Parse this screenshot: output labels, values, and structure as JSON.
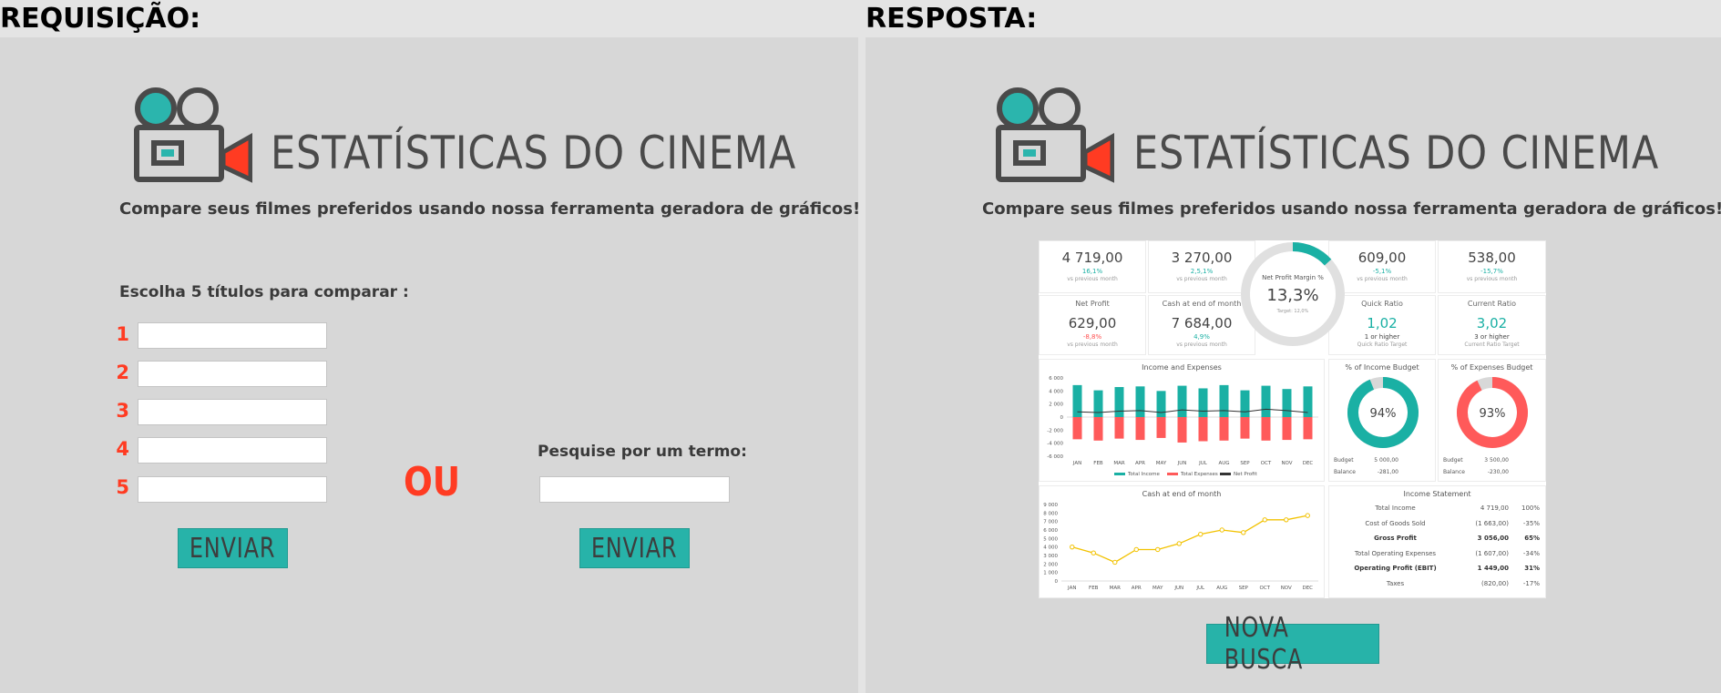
{
  "headers": {
    "left": "REQUISIÇÃO:",
    "right": "RESPOSTA:"
  },
  "logo": {
    "title": "ESTATÍSTICAS DO CINEMA",
    "subtitle": "Compare seus filmes preferidos usando nossa ferramenta geradora de gráficos!"
  },
  "colors": {
    "teal": "#27b3a9",
    "red": "#ff3b22",
    "dark": "#4a4a4a",
    "panel": "#d7d7d7"
  },
  "request": {
    "choose_label": "Escolha 5 títulos para comparar :",
    "numbers": [
      "1",
      "2",
      "3",
      "4",
      "5"
    ],
    "titles": [
      "",
      "",
      "",
      "",
      ""
    ],
    "or_label": "OU",
    "search_label": "Pesquise por um termo:",
    "search_value": "",
    "submit_titles": "ENVIAR",
    "submit_search": "ENVIAR"
  },
  "response": {
    "new_search": "NOVA BUSCA",
    "kpis": [
      {
        "value": "4 719,00",
        "change": "16,1%",
        "note": "vs previous month",
        "title": ""
      },
      {
        "value": "3 270,00",
        "change": "2,5,1%",
        "note": "vs previous month",
        "title": ""
      },
      {
        "value": "609,00",
        "change": "-5,1%",
        "note": "vs previous month",
        "title": ""
      },
      {
        "value": "538,00",
        "change": "-15,7%",
        "note": "vs previous month",
        "title": ""
      }
    ],
    "kpis2": [
      {
        "title": "Net Profit",
        "value": "629,00",
        "change": "-8,8%",
        "note": "vs previous month"
      },
      {
        "title": "Cash at end of month",
        "value": "7 684,00",
        "change": "4,9%",
        "note": "vs previous month"
      },
      {
        "title": "Quick Ratio",
        "value": "1,02",
        "change": "1 or higher",
        "note": "Quick Ratio Target"
      },
      {
        "title": "Current Ratio",
        "value": "3,02",
        "change": "3 or higher",
        "note": "Current Ratio Target"
      }
    ],
    "margin": {
      "title": "Net Profit Margin %",
      "value": "13,3%",
      "target": "Target: 12,0%",
      "fraction": 0.133
    },
    "income_budget": {
      "title": "% of Income Budget",
      "value": "94%",
      "fraction": 0.94,
      "budget_label": "Budget",
      "budget": "5 000,00",
      "balance_label": "Balance",
      "balance": "-281,00"
    },
    "expense_budget": {
      "title": "% of Expenses Budget",
      "value": "93%",
      "fraction": 0.93,
      "budget_label": "Budget",
      "budget": "3 500,00",
      "balance_label": "Balance",
      "balance": "-230,00"
    },
    "income_statement": {
      "title": "Income Statement",
      "rows": [
        {
          "label": "Total Income",
          "value": "4 719,00",
          "pct": "100%",
          "bold": false
        },
        {
          "label": "Cost of Goods Sold",
          "value": "(1 663,00)",
          "pct": "-35%",
          "bold": false
        },
        {
          "label": "Gross Profit",
          "value": "3 056,00",
          "pct": "65%",
          "bold": true
        },
        {
          "label": "Total Operating Expenses",
          "value": "(1 607,00)",
          "pct": "-34%",
          "bold": false
        },
        {
          "label": "Operating Profit (EBIT)",
          "value": "1 449,00",
          "pct": "31%",
          "bold": true
        },
        {
          "label": "Taxes",
          "value": "(820,00)",
          "pct": "-17%",
          "bold": false
        }
      ]
    }
  },
  "chart_data": [
    {
      "type": "bar",
      "title": "Income and Expenses",
      "categories": [
        "JAN",
        "FEB",
        "MAR",
        "APR",
        "MAY",
        "JUN",
        "JUL",
        "AUG",
        "SEP",
        "OCT",
        "NOV",
        "DEC"
      ],
      "series": [
        {
          "name": "Total Income",
          "color": "#1ab0a4",
          "values": [
            4900,
            4100,
            4600,
            4700,
            4000,
            4800,
            4400,
            4900,
            4100,
            4800,
            4300,
            4700
          ]
        },
        {
          "name": "Total Expenses",
          "color": "#ff5a5a",
          "values": [
            -3400,
            -3600,
            -3300,
            -3500,
            -3200,
            -3900,
            -3700,
            -3600,
            -3300,
            -3600,
            -3500,
            -3400
          ]
        },
        {
          "name": "Net Profit",
          "color": "#333333",
          "values": [
            800,
            700,
            900,
            1000,
            700,
            1100,
            900,
            1000,
            800,
            1200,
            1000,
            700
          ]
        }
      ],
      "yticks": [
        "6 000",
        "4 000",
        "2 000",
        "0",
        "-2 000",
        "-4 000",
        "-6 000"
      ],
      "ylim": [
        -6000,
        6000
      ]
    },
    {
      "type": "line",
      "title": "Cash at end of month",
      "categories": [
        "JAN",
        "FEB",
        "MAR",
        "APR",
        "MAY",
        "JUN",
        "JUL",
        "AUG",
        "SEP",
        "OCT",
        "NOV",
        "DEC"
      ],
      "series": [
        {
          "color": "#f2c200",
          "values": [
            4000,
            3300,
            2200,
            3700,
            3700,
            4400,
            5500,
            6000,
            5700,
            7200,
            7200,
            7700
          ]
        }
      ],
      "yticks": [
        "9 000",
        "8 000",
        "7 000",
        "6 000",
        "5 000",
        "4 000",
        "3 000",
        "2 000",
        "1 000",
        "0"
      ],
      "ylim": [
        0,
        9000
      ]
    }
  ]
}
